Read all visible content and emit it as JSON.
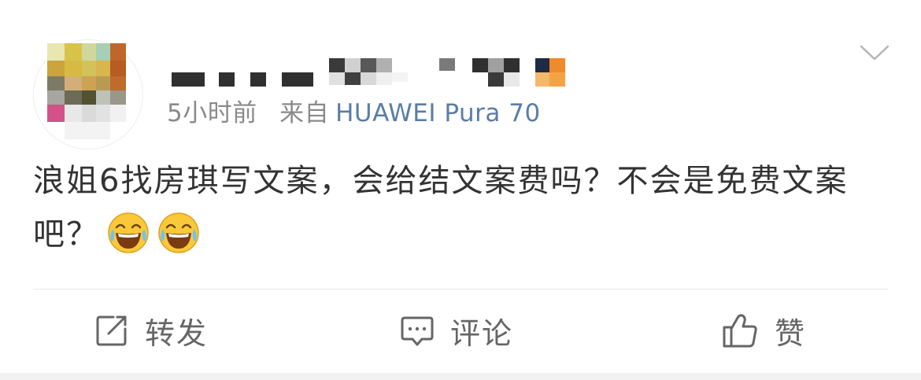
{
  "post": {
    "time": "5小时前",
    "source_prefix": "来自",
    "source_name": "HUAWEI Pura 70",
    "text": "浪姐6找房琪写文案，会给结文案费吗？不会是免费文案吧？",
    "emojis": [
      "laugh-cry-emoji",
      "laugh-cry-emoji"
    ]
  },
  "actions": {
    "repost_label": "转发",
    "comment_label": "评论",
    "like_label": "赞"
  },
  "colors": {
    "text": "#333333",
    "meta": "#8a8a8a",
    "source_link": "#5b7da7",
    "action_icon": "#666666"
  }
}
